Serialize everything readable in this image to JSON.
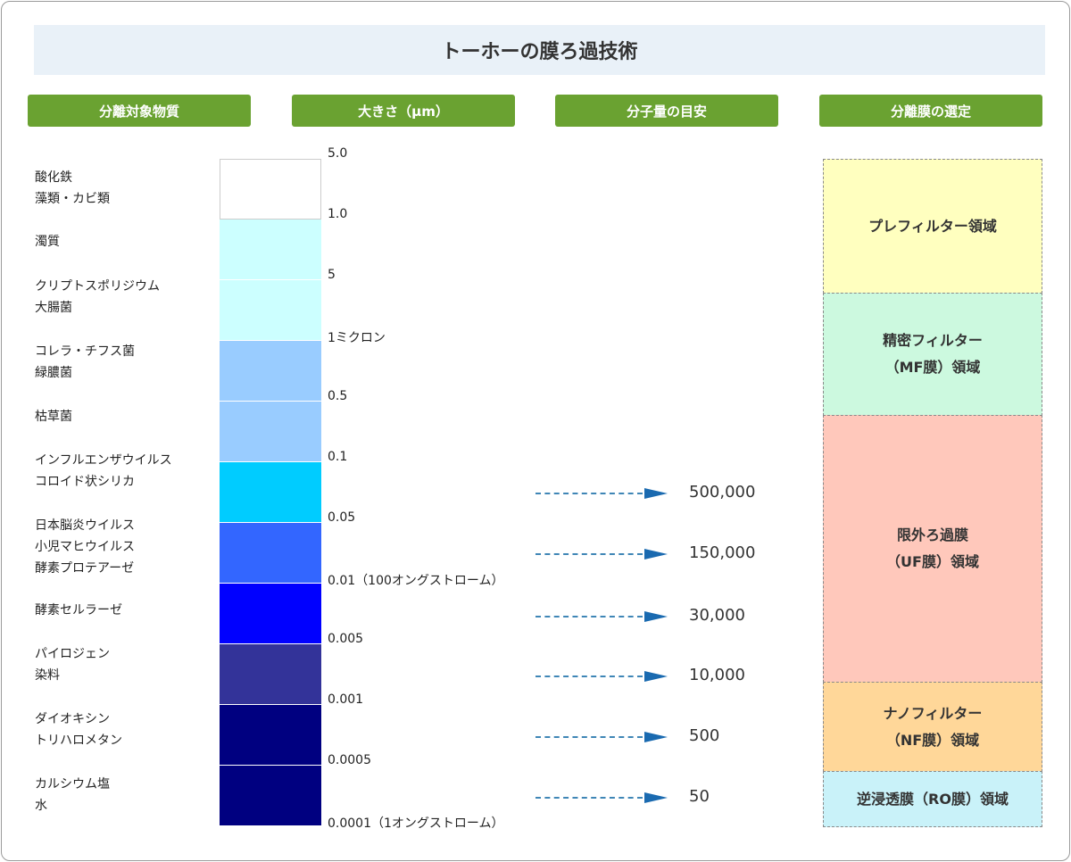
{
  "title": "トーホーの膜ろ過技術",
  "headers": [
    "分離対象物質",
    "大きさ（μm）",
    "分子量の目安",
    "分離膜の選定"
  ],
  "substances": [
    [
      "酸化鉄",
      "藻類・カビ類"
    ],
    [
      "濁質"
    ],
    [
      "クリプトスポリジウム",
      "大腸菌"
    ],
    [
      "コレラ・チフス菌",
      "緑膿菌"
    ],
    [
      "枯草菌"
    ],
    [
      "インフルエンザウイルス",
      "コロイド状シリカ"
    ],
    [
      "日本脳炎ウイルス",
      "小児マヒウイルス",
      "酵素プロテアーゼ"
    ],
    [
      "酵素セルラーゼ"
    ],
    [
      "パイロジェン",
      "染料"
    ],
    [
      "ダイオキシン",
      "トリハロメタン"
    ],
    [
      "カルシウム塩",
      "水"
    ]
  ],
  "scale_colors": [
    "#ffffff",
    "#ccffff",
    "#ccffff",
    "#99ccff",
    "#99ccff",
    "#00ccff",
    "#3366ff",
    "#0000ff",
    "#333399",
    "#000080",
    "#000080"
  ],
  "size_labels": [
    "5.0",
    "1.0",
    "5",
    "1ミクロン",
    "0.5",
    "0.1",
    "0.05",
    "0.01（100オングストローム）",
    "0.005",
    "0.001",
    "0.0005",
    "0.0001（1オングストローム）"
  ],
  "molecular_weights": [
    "500,000",
    "150,000",
    "30,000",
    "10,000",
    "500",
    "50"
  ],
  "regions": [
    {
      "lines": [
        "プレフィルター領域"
      ],
      "color": "#ffffbf"
    },
    {
      "lines": [
        "精密フィルター",
        "（MF膜）領域"
      ],
      "color": "#ccf9df"
    },
    {
      "lines": [
        "限外ろ過膜",
        "（UF膜）領域"
      ],
      "color": "#ffc8bb"
    },
    {
      "lines": [
        "ナノフィルター",
        "（NF膜）領域"
      ],
      "color": "#ffd799"
    },
    {
      "lines": [
        "逆浸透膜（RO膜）領域"
      ],
      "color": "#c9f2f9"
    }
  ]
}
